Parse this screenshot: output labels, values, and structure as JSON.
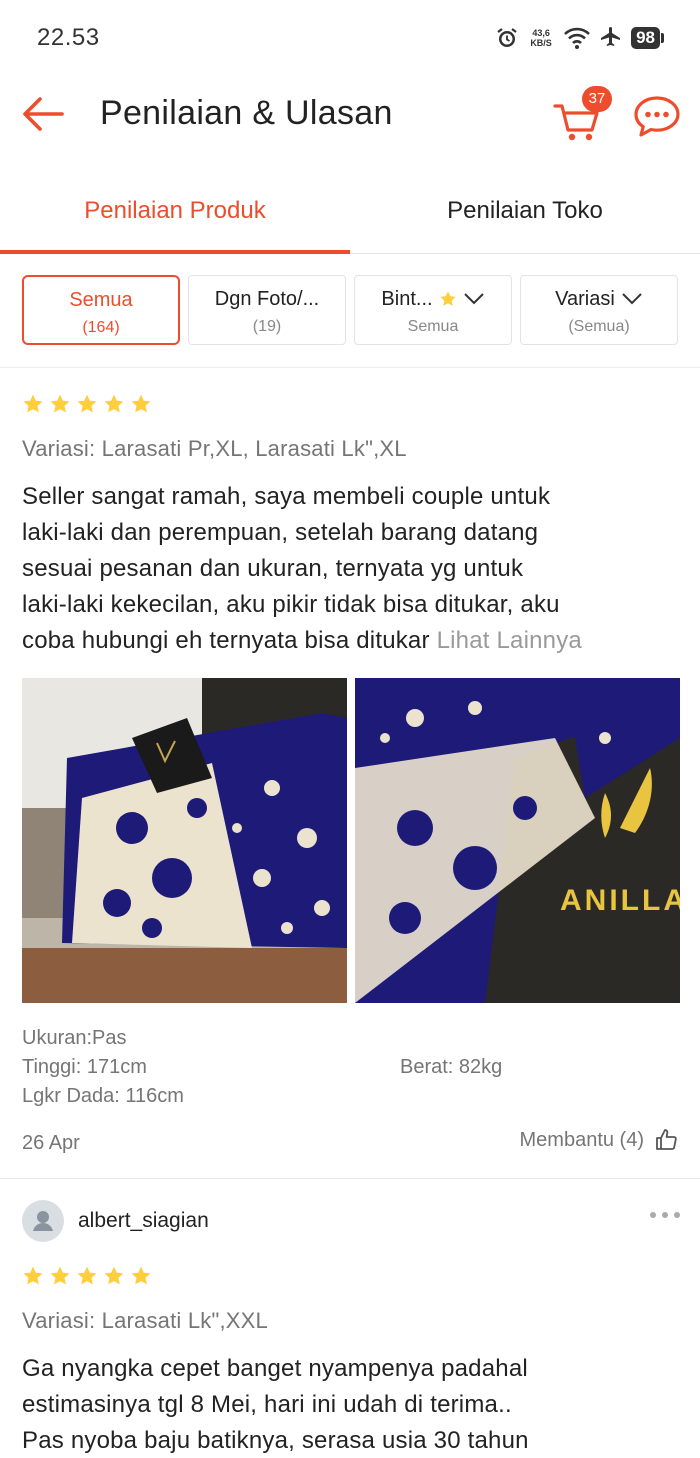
{
  "status_bar": {
    "time": "22.53",
    "net_speed_value": "43,6",
    "net_speed_unit": "KB/S",
    "battery": "98"
  },
  "header": {
    "title": "Penilaian & Ulasan",
    "cart_count": "37"
  },
  "tabs": [
    {
      "label": "Penilaian Produk",
      "active": true
    },
    {
      "label": "Penilaian Toko",
      "active": false
    }
  ],
  "filters": [
    {
      "label": "Semua",
      "sub": "(164)",
      "active": true
    },
    {
      "label": "Dgn Foto/...",
      "sub": "(19)"
    },
    {
      "label": "Bint...",
      "sub": "Semua"
    },
    {
      "label": "Variasi",
      "sub": "(Semua)"
    }
  ],
  "reviews": [
    {
      "rating": 5,
      "variation": "Variasi: Larasati Pr,XL, Larasati Lk\",XL",
      "text_lines": [
        "Seller sangat ramah, saya membeli couple untuk",
        "laki-laki dan perempuan, setelah barang datang",
        "sesuai pesanan dan ukuran, ternyata yg untuk",
        "laki-laki kekecilan, aku pikir tidak bisa ditukar, aku",
        "coba hubungi eh ternyata bisa ditukar"
      ],
      "see_more": "Lihat Lainnya",
      "photo_brand_text": "ANILLA",
      "ukuran": "Ukuran:Pas",
      "tinggi": "Tinggi: 171cm",
      "berat": "Berat: 82kg",
      "lingkar_dada": "Lgkr Dada: 116cm",
      "date": "26 Apr",
      "helpful": "Membantu (4)"
    },
    {
      "username": "albert_siagian",
      "rating": 5,
      "variation": "Variasi: Larasati Lk\",XXL",
      "text_lines": [
        "Ga nyangka cepet banget nyampenya padahal",
        "estimasinya tgl 8 Mei, hari ini udah di terima..",
        "Pas nyoba baju batiknya, serasa usia 30 tahun"
      ]
    }
  ],
  "colors": {
    "accent": "#ee4d2d",
    "star": "#ffce3d",
    "batik_blue": "#1e1a78",
    "batik_cream": "#ece3cf"
  },
  "icons": [
    "alarm-icon",
    "wifi-icon",
    "airplane-icon",
    "back-arrow-icon",
    "cart-icon",
    "chat-icon",
    "star-icon",
    "chevron-down-icon",
    "thumbs-up-icon",
    "user-icon",
    "more-icon"
  ]
}
